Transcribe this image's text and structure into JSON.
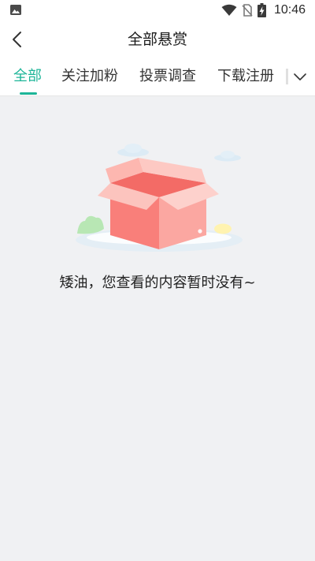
{
  "status_bar": {
    "time": "10:46",
    "icons": [
      "image-icon",
      "wifi-icon",
      "no-sim-icon",
      "battery-charging-icon"
    ]
  },
  "header": {
    "title": "全部悬赏",
    "back_icon": "chevron-left-icon"
  },
  "tabs": {
    "items": [
      {
        "label": "全部",
        "active": true
      },
      {
        "label": "关注加粉",
        "active": false
      },
      {
        "label": "投票调查",
        "active": false
      },
      {
        "label": "下载注册",
        "active": false
      }
    ],
    "more_icon": "chevron-down-icon"
  },
  "empty_state": {
    "illustration": "open-box-illustration",
    "message": "矮油，您查看的内容暂时没有~"
  },
  "colors": {
    "accent": "#1db598",
    "background": "#f0f1f3",
    "box": "#f97f7a"
  }
}
